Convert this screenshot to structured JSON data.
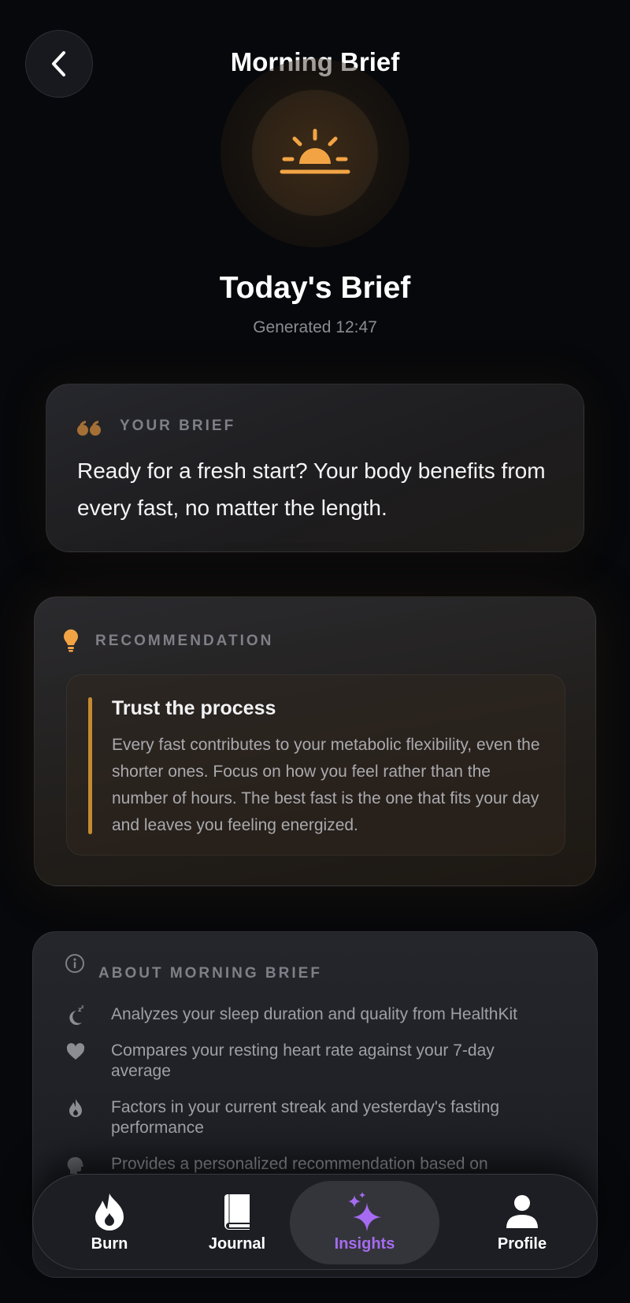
{
  "header": {
    "title": "Morning Brief"
  },
  "hero": {
    "title": "Today's Brief",
    "generated": "Generated 12:47"
  },
  "brief": {
    "label": "YOUR BRIEF",
    "text": "Ready for a fresh start? Your body benefits from every fast, no matter the length."
  },
  "recommendation": {
    "label": "RECOMMENDATION",
    "title": "Trust the process",
    "text": "Every fast contributes to your metabolic flexibility, even the shorter ones. Focus on how you feel rather than the number of hours. The best fast is the one that fits your day and leaves you feeling energized."
  },
  "about": {
    "label": "ABOUT MORNING BRIEF",
    "items": [
      {
        "icon": "moon-zzz-icon",
        "text": "Analyzes your sleep duration and quality from HealthKit"
      },
      {
        "icon": "heart-icon",
        "text": "Compares your resting heart rate against your 7-day average"
      },
      {
        "icon": "flame-icon",
        "text": "Factors in your current streak and yesterday's fasting performance"
      },
      {
        "icon": "brain-icon",
        "text": "Provides a personalized recommendation based on"
      }
    ]
  },
  "tabs": [
    {
      "label": "Burn",
      "icon": "flame-icon"
    },
    {
      "label": "Journal",
      "icon": "book-icon"
    },
    {
      "label": "Insights",
      "icon": "sparkles-icon",
      "active": true
    },
    {
      "label": "Profile",
      "icon": "person-icon"
    }
  ],
  "colors": {
    "background": "#07080b",
    "accent_orange": "#f2a445",
    "accent_purple": "#a66bf0",
    "rec_bar": "#c48a30"
  }
}
